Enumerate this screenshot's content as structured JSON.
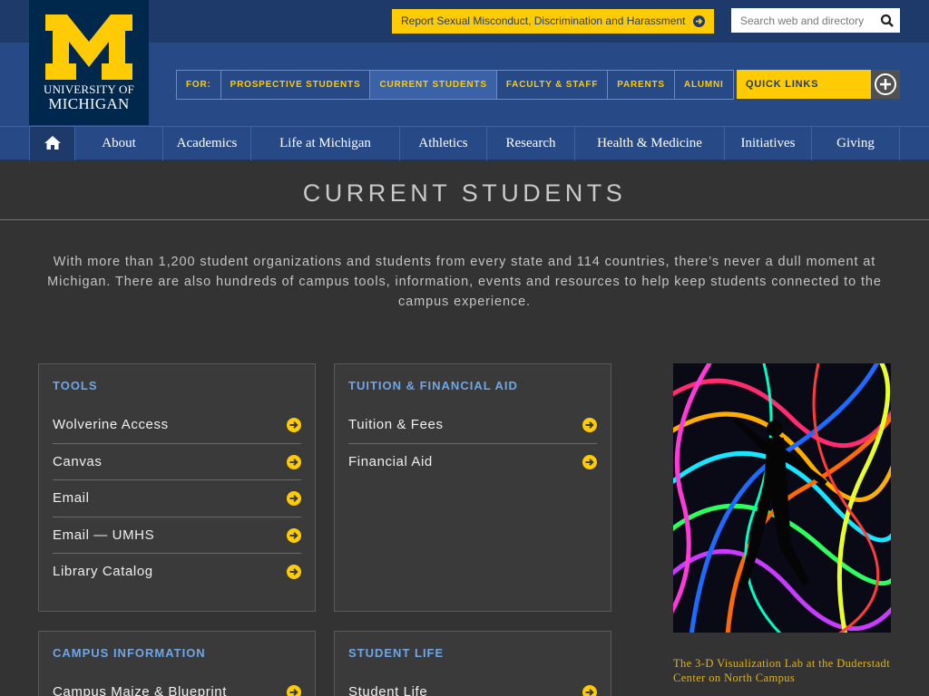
{
  "header": {
    "logo_line1": "UNIVERSITY OF",
    "logo_line2": "MICHIGAN",
    "report_label": "Report Sexual Misconduct, Discrimination and Harassment",
    "search_placeholder": "Search web and directory",
    "audience": [
      "FOR:",
      "PROSPECTIVE STUDENTS",
      "CURRENT STUDENTS",
      "FACULTY & STAFF",
      "PARENTS",
      "ALUMNI"
    ],
    "quick_links": "QUICK LINKS"
  },
  "nav": [
    "About",
    "Academics",
    "Life at Michigan",
    "Athletics",
    "Research",
    "Health & Medicine",
    "Initiatives",
    "Giving"
  ],
  "page": {
    "title": "CURRENT STUDENTS",
    "intro": "With more than 1,200 student organizations and students from every state and 114 countries, there’s never a dull moment at Michigan. There are also hundreds of campus tools, information, events and resources to help keep students connected to the campus experience."
  },
  "boxes": {
    "tools": {
      "title": "TOOLS",
      "items": [
        "Wolverine Access",
        "Canvas",
        "Email",
        "Email — UMHS",
        "Library Catalog"
      ]
    },
    "tuition": {
      "title": "TUITION & FINANCIAL AID",
      "items": [
        "Tuition & Fees",
        "Financial Aid"
      ]
    },
    "campus": {
      "title": "CAMPUS INFORMATION",
      "items": [
        "Campus Maize & Blueprint"
      ]
    },
    "student_life": {
      "title": "STUDENT LIFE",
      "items": [
        "Student Life"
      ]
    }
  },
  "photo": {
    "caption": "The 3-D Visualization Lab at the Duderstadt Center on North Campus"
  },
  "colors": {
    "maize": "#ffcb05",
    "blue": "#00274c",
    "nav_blue": "#274a86",
    "link_blue": "#6fa6e6"
  }
}
